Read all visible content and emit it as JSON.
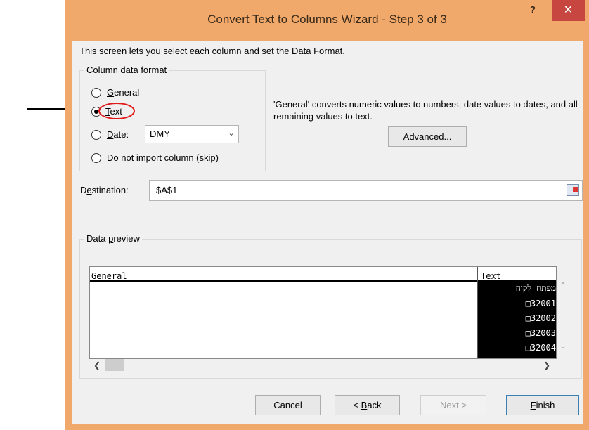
{
  "window": {
    "title": "Convert Text to Columns Wizard - Step 3 of 3",
    "help_label": "?",
    "close_label": "✕"
  },
  "intro_text": "This screen lets you select each column and set the Data Format.",
  "column_format": {
    "legend": "Column data format",
    "options": [
      {
        "label": "General",
        "selected": false
      },
      {
        "label": "Text",
        "selected": true
      },
      {
        "label": "Date:",
        "selected": false
      },
      {
        "label": "Do not import column (skip)",
        "selected": false
      }
    ],
    "date_format": "DMY"
  },
  "description": "'General' converts numeric values to numbers, date values to dates, and all remaining values to text.",
  "advanced_label": "Advanced...",
  "destination": {
    "label": "Destination:",
    "value": "$A$1"
  },
  "preview": {
    "legend": "Data preview",
    "headers": [
      "General",
      "Text"
    ],
    "text_column_values": [
      "מפתח לקוח",
      "□32001",
      "□32002",
      "□32003",
      "□32004"
    ]
  },
  "buttons": {
    "cancel": "Cancel",
    "back": "< Back",
    "next": "Next >",
    "finish": "Finish"
  },
  "colors": {
    "frame": "#f0a96a",
    "close_button": "#c7463f",
    "highlight_ellipse": "#e01a1a"
  }
}
